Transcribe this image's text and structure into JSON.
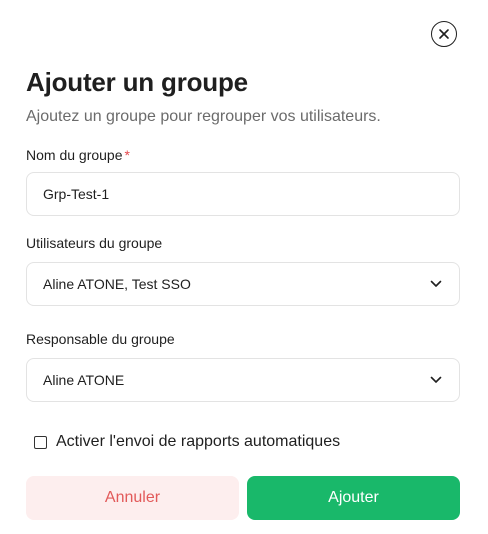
{
  "modal": {
    "title": "Ajouter un groupe",
    "subtitle": "Ajoutez un groupe pour regrouper vos utilisateurs."
  },
  "fields": {
    "group_name": {
      "label": "Nom du groupe",
      "required_mark": "*",
      "value": "Grp-Test-1"
    },
    "group_users": {
      "label": "Utilisateurs du groupe",
      "value": "Aline ATONE, Test SSO"
    },
    "group_manager": {
      "label": "Responsable du groupe",
      "value": "Aline ATONE"
    }
  },
  "options": {
    "auto_reports_label": "Activer l'envoi de rapports automatiques",
    "auto_reports_checked": false
  },
  "actions": {
    "cancel_label": "Annuler",
    "submit_label": "Ajouter"
  },
  "icons": {
    "close": "close-icon",
    "chevron": "chevron-down-icon"
  },
  "colors": {
    "primary": "#19b86a",
    "cancel_bg": "#fdeeee",
    "cancel_text": "#e25a5a",
    "required": "#e5484d"
  }
}
